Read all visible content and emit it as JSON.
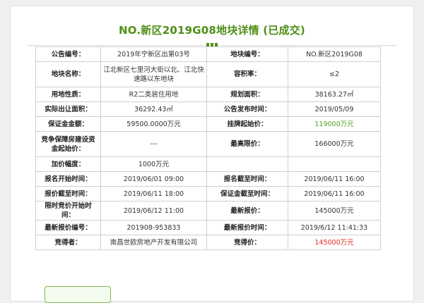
{
  "title": "NO.新区2019G08地块详情 (已成交)",
  "colors": {
    "accent_green": "#4f8f17",
    "price_green": "#56a01e",
    "price_red": "#e3281c"
  },
  "rows": [
    {
      "l1": "公告编号：",
      "v1": "2019年宁新区出第03号",
      "l2": "地块编号：",
      "v2": "NO.新区2019G08"
    },
    {
      "l1": "地块名称：",
      "v1": "江北新区七里河大街以北、江北快速路以东地块",
      "l2": "容积率：",
      "v2": "≤2"
    },
    {
      "l1": "用地性质：",
      "v1": "R2二类居住用地",
      "l2": "规划面积：",
      "v2": "38163.27㎡"
    },
    {
      "l1": "实际出让面积：",
      "v1": "36292.43㎡",
      "l2": "公告发布时间：",
      "v2": "2019/05/09"
    },
    {
      "l1": "保证金金额：",
      "v1": "59500.0000万元",
      "l2": "挂牌起始价：",
      "v2": "119000万元"
    },
    {
      "l1": "竞争保障房建设资金起始价：",
      "v1": "---",
      "l2": "最高限价：",
      "v2": "166000万元"
    },
    {
      "l1": "加价幅度：",
      "v1": "1000万元",
      "l2": "",
      "v2": ""
    },
    {
      "l1": "报名开始时间：",
      "v1": "2019/06/01 09:00",
      "l2": "报名截至时间：",
      "v2": "2019/06/11 16:00"
    },
    {
      "l1": "报价截至时间：",
      "v1": "2019/06/11 18:00",
      "l2": "保证金截至时间：",
      "v2": "2019/06/11 16:00"
    },
    {
      "l1": "限时竞价开始时间：",
      "v1": "2019/06/12 11:00",
      "l2": "最新报价：",
      "v2": "145000万元"
    },
    {
      "l1": "最新报价编号：",
      "v1": "201908-953833",
      "l2": "最新报价时间：",
      "v2": "2019/6/12 11:41:33"
    },
    {
      "l1": "竞得者：",
      "v1": "南昌世欧房地产开发有限公司",
      "l2": "竞得价：",
      "v2": "145000万元"
    }
  ]
}
